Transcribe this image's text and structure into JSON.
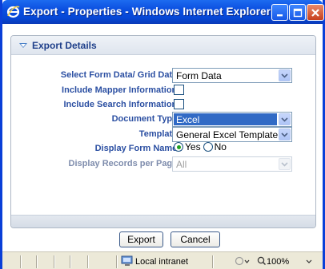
{
  "window": {
    "title": "Export - Properties - Windows Internet Explorer"
  },
  "section": {
    "title": "Export Details"
  },
  "form": {
    "select_form_data": {
      "label": "Select Form Data/ Grid Data :",
      "value": "Form Data"
    },
    "include_mapper": {
      "label": "Include Mapper Information :",
      "checked": false
    },
    "include_search": {
      "label": "Include Search Information :",
      "checked": false
    },
    "document_type": {
      "label": "Document Type :",
      "value": "Excel"
    },
    "template": {
      "label": "Template :",
      "value": "General Excel Template"
    },
    "display_form_name": {
      "label": "Display Form Name :",
      "options": [
        "Yes",
        "No"
      ],
      "selected": "Yes"
    },
    "records_per_page": {
      "label": "Display Records per Page :",
      "value": "All",
      "disabled": true
    }
  },
  "buttons": {
    "export": "Export",
    "cancel": "Cancel"
  },
  "statusbar": {
    "zone": "Local intranet",
    "zoom": "100%"
  },
  "colors": {
    "titlebar": "#0b4fe0",
    "label": "#2b4fa2",
    "selection": "#316ac5"
  }
}
